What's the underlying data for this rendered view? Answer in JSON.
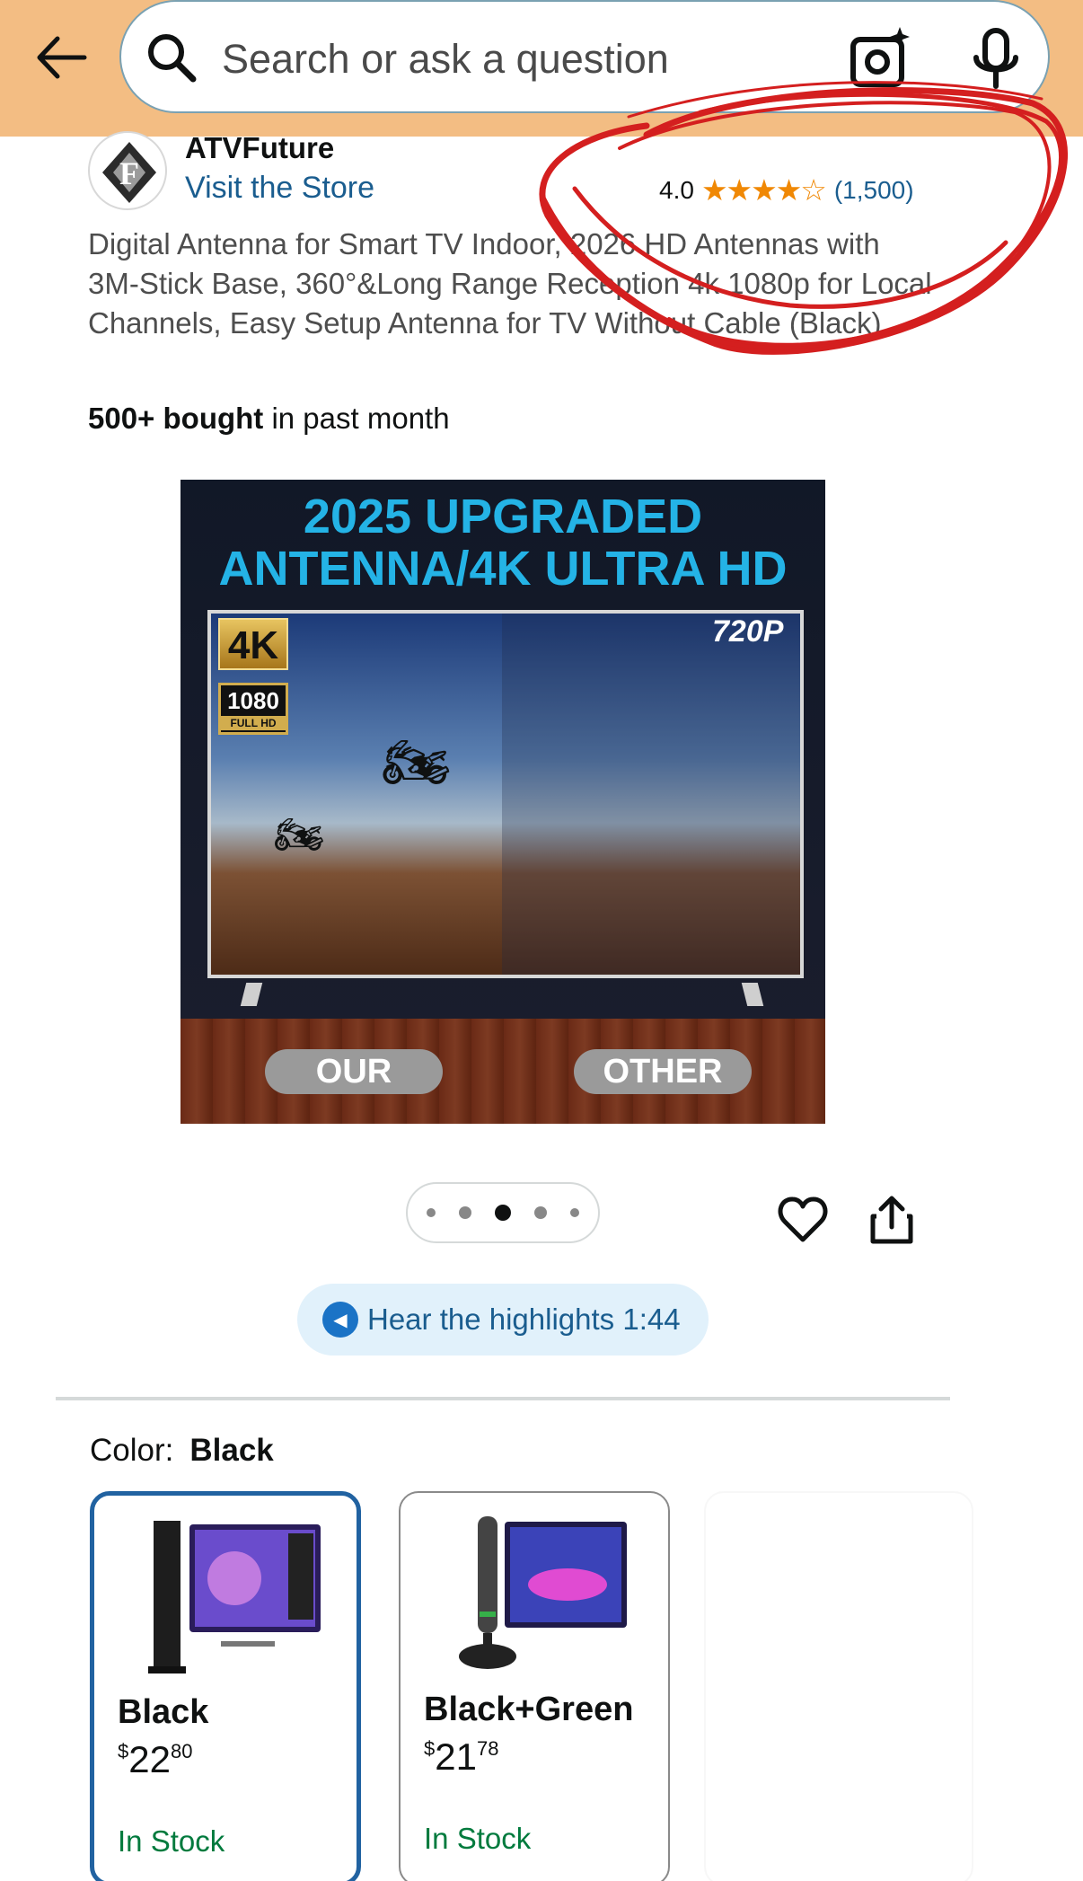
{
  "header": {
    "search_placeholder": "Search or ask a question",
    "back_icon": "arrow-left-icon",
    "camera_icon": "camera-sparkle-icon",
    "mic_icon": "microphone-icon",
    "background_color": "#f3bd83"
  },
  "brand": {
    "name": "ATVFuture",
    "store_link": "Visit the Store",
    "logo_letter": "F"
  },
  "rating": {
    "value": "4.0",
    "stars": "★★★★☆",
    "count": "(1,500)",
    "star_color": "#f08804"
  },
  "product": {
    "title": "Digital Antenna for Smart TV Indoor, 2026 HD Antennas with 3M-Stick Base, 360°&Long Range Reception 4k 1080p for Local Channels, Easy Setup Antenna for TV Without Cable (Black)",
    "bought_bold": "500+ bought",
    "bought_rest": " in past month"
  },
  "image": {
    "headline_line1": "2025 UPGRADED",
    "headline_line2": "ANTENNA/4K ULTRA HD",
    "badge_4k": "4K",
    "badge_1080": "1080",
    "badge_fullhd": "FULL HD",
    "badge_720": "720P",
    "label_our": "OUR",
    "label_other": "OTHER"
  },
  "carousel": {
    "total": 5,
    "active_index": 2
  },
  "highlights": {
    "label": "Hear the highlights 1:44"
  },
  "color": {
    "label": "Color:",
    "selected": "Black",
    "options": [
      {
        "name": "Black",
        "price_whole": "22",
        "price_cents": "80",
        "currency": "$",
        "stock": "In Stock"
      },
      {
        "name": "Black+Green",
        "price_whole": "21",
        "price_cents": "78",
        "currency": "$",
        "stock": "In Stock"
      }
    ],
    "selected_border_color": "#2162a1",
    "stock_color": "#007a3d"
  }
}
